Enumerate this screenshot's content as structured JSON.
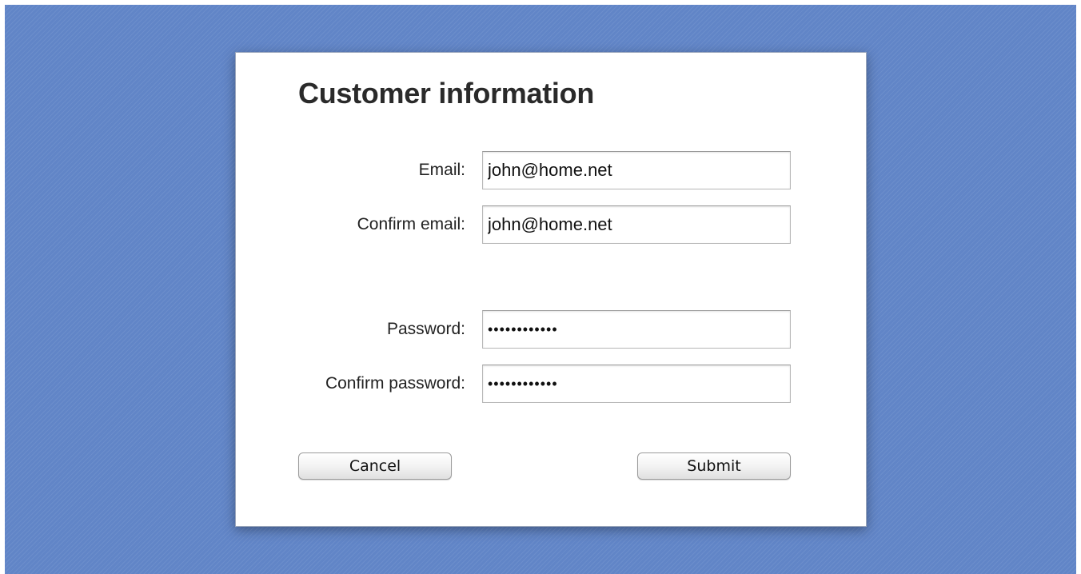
{
  "form": {
    "title": "Customer information",
    "email_label": "Email:",
    "email_value": "john@home.net",
    "confirm_email_label": "Confirm email:",
    "confirm_email_value": "john@home.net",
    "password_label": "Password:",
    "password_value": "............",
    "confirm_password_label": "Confirm password:",
    "confirm_password_value": "............"
  },
  "buttons": {
    "cancel_label": "Cancel",
    "submit_label": "Submit"
  },
  "colors": {
    "background": "#6185c7",
    "card": "#ffffff"
  }
}
